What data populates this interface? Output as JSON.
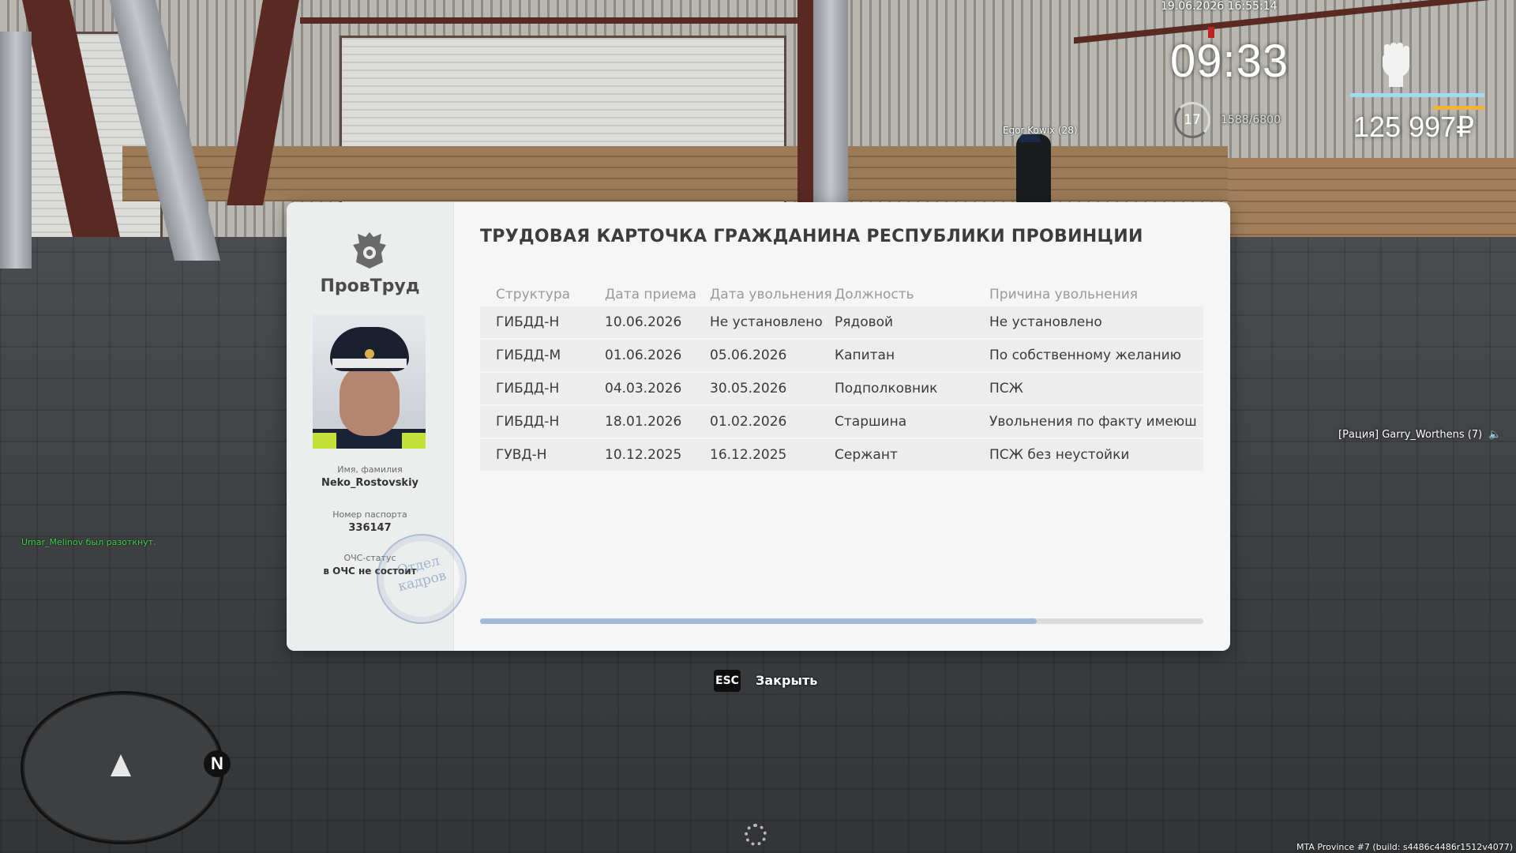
{
  "hud": {
    "datetime": "19.06.2026 16:55:14",
    "clock": "09:33",
    "money": "125 997₽",
    "level": "17",
    "xp": "1588/6800",
    "player_tag": "Egor Kowix (28)",
    "health_fraction": 1.0,
    "armor_fraction": 0.38
  },
  "chat": {
    "kick_message": "Umar_Melinov был разоткнут.",
    "radio_message": "[Рация] Garry_Worthens (7)"
  },
  "footer": {
    "build": "MTA Province #7 (build: s4486c4486r1512v4077)"
  },
  "card": {
    "title": "ТРУДОВАЯ КАРТОЧКА ГРАЖДАНИНА РЕСПУБЛИКИ ПРОВИНЦИИ",
    "org_name": "ПровТруд",
    "name_label": "Имя, фамилия",
    "name_value": "Neko_Rostovskiy",
    "passport_label": "Номер паспорта",
    "passport_value": "336147",
    "ocs_label": "ОЧС-статус",
    "ocs_value": "в ОЧС не состоит",
    "stamp_line1": "Отдел",
    "stamp_line2": "кадров",
    "columns": [
      "Структура",
      "Дата приема",
      "Дата увольнения",
      "Должность",
      "Причина увольнения"
    ],
    "rows": [
      [
        "ГИБДД-Н",
        "10.06.2026",
        "Не установлено",
        "Рядовой",
        "Не установлено"
      ],
      [
        "ГИБДД-М",
        "01.06.2026",
        "05.06.2026",
        "Капитан",
        "По собственному желанию"
      ],
      [
        "ГИБДД-Н",
        "04.03.2026",
        "30.05.2026",
        "Подполковник",
        "ПСЖ"
      ],
      [
        "ГИБДД-Н",
        "18.01.2026",
        "01.02.2026",
        "Старшина",
        "Увольнения по факту имеюш"
      ],
      [
        "ГУВД-Н",
        "10.12.2025",
        "16.12.2025",
        "Сержант",
        "ПСЖ без неустойки"
      ]
    ],
    "scroll_fraction": 0.77
  },
  "close": {
    "key": "ESC",
    "label": "Закрыть"
  },
  "radar": {
    "north": "N"
  }
}
